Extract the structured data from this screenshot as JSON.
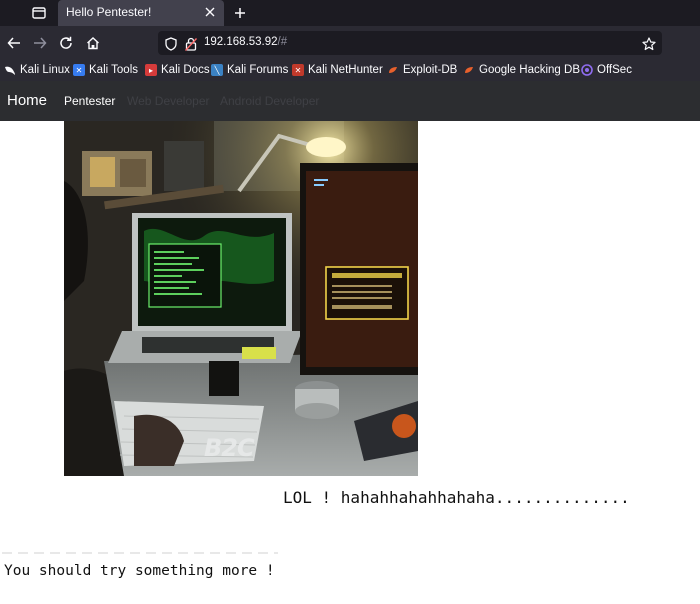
{
  "browser": {
    "tab": {
      "title": "Hello Pentester!"
    },
    "url": {
      "host": "192.168.53.92",
      "path": "/#"
    },
    "bookmarks": [
      {
        "label": "Kali Linux",
        "icon": "kali-dragon-icon"
      },
      {
        "label": "Kali Tools",
        "icon": "kali-tools-icon"
      },
      {
        "label": "Kali Docs",
        "icon": "kali-docs-icon"
      },
      {
        "label": "Kali Forums",
        "icon": "kali-forums-icon"
      },
      {
        "label": "Kali NetHunter",
        "icon": "kali-nethunter-icon"
      },
      {
        "label": "Exploit-DB",
        "icon": "exploit-db-icon"
      },
      {
        "label": "Google Hacking DB",
        "icon": "ghdb-icon"
      },
      {
        "label": "OffSec",
        "icon": "offsec-icon"
      }
    ]
  },
  "site": {
    "brand": "Home",
    "nav": [
      {
        "label": "Pentester",
        "active": true
      },
      {
        "label": "Web Developer",
        "active": false
      },
      {
        "label": "Android Developer",
        "active": false
      }
    ]
  },
  "content": {
    "image_watermark": "B2C",
    "image_alt": "hacker desk with laptops",
    "caption_main": "LOL ! hahahhahahhahaha..............",
    "caption_secondary": "You should try something more !"
  },
  "colors": {
    "chrome_dark": "#1c1b22",
    "chrome": "#2b2a33",
    "tab_active": "#42414d",
    "page_nav": "#2c2d30"
  }
}
